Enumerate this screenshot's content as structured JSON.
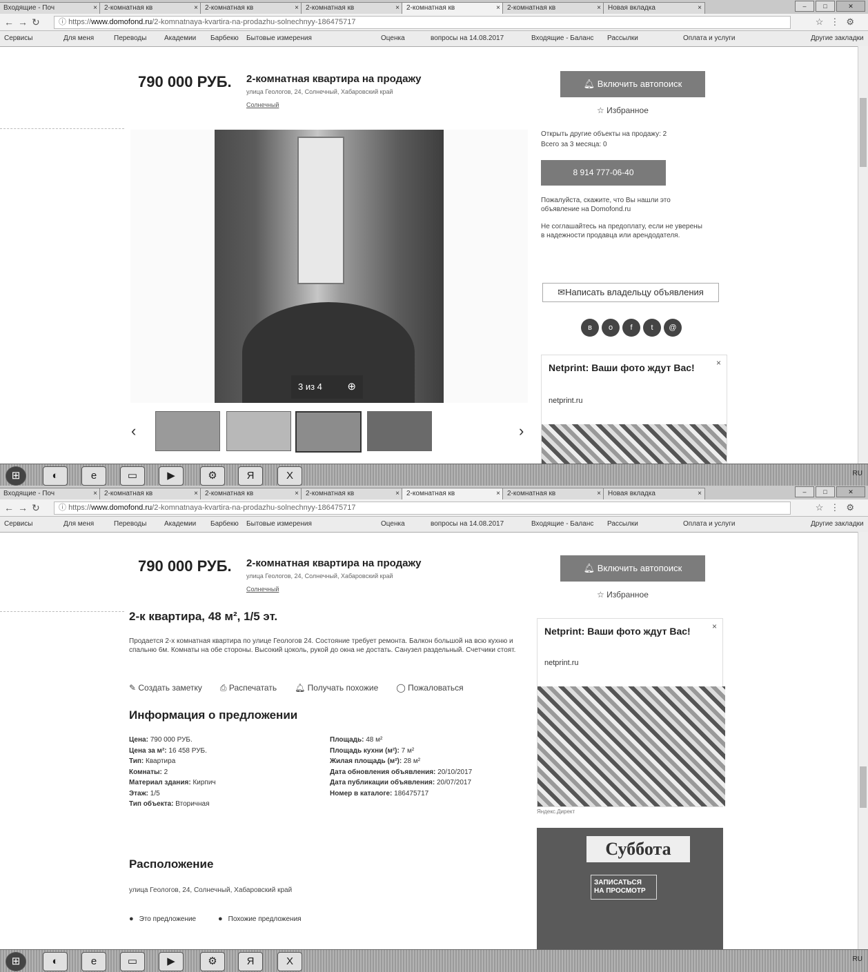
{
  "browser": {
    "tabs": [
      "Входящие - Поч",
      "2-комнатная кв",
      "2-комнатная кв",
      "2-комнатная кв",
      "2-комнатная кв",
      "2-комнатная кв",
      "Новая вкладка"
    ],
    "url_prefix": "https://",
    "url_host": "www.domofond.ru",
    "url_path": "/2-komnatnaya-kvartira-na-prodazhu-solnechnyy-186475717",
    "bookmarks": [
      "Сервисы",
      "Для меня",
      "Переводы",
      "Академии",
      "Барбекю",
      "Бытовые измерения",
      "Оценка",
      "вопросы на 14.08.2017",
      "Входящие - Баланс",
      "Рассылки",
      "Оплата и услуги",
      "Другие закладки"
    ]
  },
  "listing": {
    "price": "790 000 РУБ.",
    "title": "2-комнатная квартира на продажу",
    "address": "улица Геологов, 24, Солнечный, Хабаровский край",
    "city": "Солнечный",
    "subscribe_button": "Включить автопоиск",
    "favorite": "Избранное"
  },
  "gallery": {
    "counter": "3 из 4",
    "thumbnails_count": 4
  },
  "sidebar": {
    "other_ads": "Открыть другие объекты на продажу: 2",
    "total_3months": "Всего за 3 месяца: 0",
    "phone": "8 914 777-06-40",
    "note1": "Пожалуйста, скажите, что Вы нашли это объявление на Domofond.ru",
    "note2": "Не соглашайтесь на предоплату, если не уверены в надежности продавца или арендодателя.",
    "write_button": "Написать владельцу объявления"
  },
  "ad": {
    "title": "Netprint: Ваши фото ждут Вас!",
    "url": "netprint.ru",
    "close": "×",
    "label": "Яндекс.Директ",
    "banner_title": "Суббота",
    "banner_cta": "ЗАПИСАТЬСЯ НА ПРОСМОТР"
  },
  "details": {
    "heading": "2-к квартира, 48 м², 1/5 эт.",
    "description": "Продается 2-х комнатная квартира по улице Геологов 24. Состояние требует ремонта. Балкон большой на всю кухню и спальню 6м. Комнаты на обе стороны. Высокий цоколь, рукой до окна не достать. Санузел раздельный. Счетчики стоят.",
    "actions": [
      "Создать заметку",
      "Распечатать",
      "Получать похожие",
      "Пожаловаться"
    ],
    "info_heading": "Информация о предложении",
    "info_left": [
      {
        "label": "Цена:",
        "value": "790 000 РУБ."
      },
      {
        "label": "Цена за м²:",
        "value": "16 458 РУБ."
      },
      {
        "label": "Тип:",
        "value": "Квартира"
      },
      {
        "label": "Комнаты:",
        "value": "2"
      },
      {
        "label": "Материал здания:",
        "value": "Кирпич"
      },
      {
        "label": "Этаж:",
        "value": "1/5"
      },
      {
        "label": "Тип объекта:",
        "value": "Вторичная"
      }
    ],
    "info_right": [
      {
        "label": "Площадь:",
        "value": "48 м²"
      },
      {
        "label": "Площадь кухни (м²):",
        "value": "7 м²"
      },
      {
        "label": "Жилая площадь (м²):",
        "value": "28 м²"
      },
      {
        "label": "Дата обновления объявления:",
        "value": "20/10/2017"
      },
      {
        "label": "Дата публикации объявления:",
        "value": "20/07/2017"
      },
      {
        "label": "Номер в каталоге:",
        "value": "186475717"
      }
    ],
    "location_heading": "Расположение",
    "location_address": "улица Геологов, 24, Солнечный, Хабаровский край",
    "map_options": [
      "Это предложение",
      "Похожие предложения"
    ]
  },
  "taskbar": {
    "icons": [
      "start",
      "chrome",
      "explorer",
      "folder",
      "media",
      "settings",
      "yandex",
      "excel"
    ],
    "tray": "RU"
  }
}
